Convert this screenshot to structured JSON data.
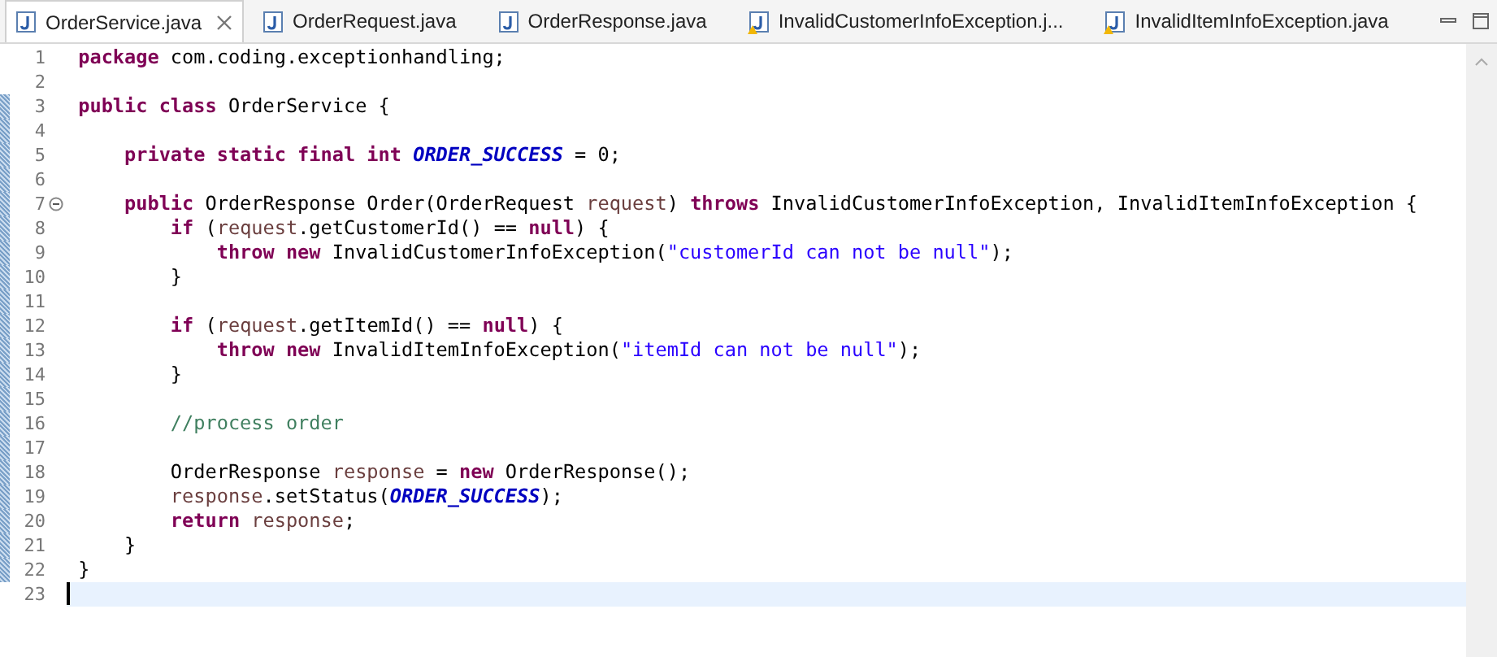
{
  "tabs": [
    {
      "label": "OrderService.java",
      "selected": true,
      "warning": false,
      "closable": true
    },
    {
      "label": "OrderRequest.java",
      "selected": false,
      "warning": false,
      "closable": false
    },
    {
      "label": "OrderResponse.java",
      "selected": false,
      "warning": false,
      "closable": false
    },
    {
      "label": "InvalidCustomerInfoException.j...",
      "selected": false,
      "warning": true,
      "closable": false
    },
    {
      "label": "InvalidItemInfoException.java",
      "selected": false,
      "warning": true,
      "closable": false
    }
  ],
  "editor": {
    "lines": [
      {
        "number": "1",
        "changed": false,
        "foldable": false,
        "current": false,
        "tokens": [
          {
            "kind": "keyword",
            "text": "package"
          },
          {
            "kind": "plain",
            "text": " com.coding.exceptionhandling;"
          }
        ]
      },
      {
        "number": "2",
        "changed": false,
        "foldable": false,
        "current": false
      },
      {
        "number": "3",
        "changed": true,
        "foldable": false,
        "current": false,
        "tokens": [
          {
            "kind": "keyword",
            "text": "public class"
          },
          {
            "kind": "plain",
            "text": " OrderService {"
          }
        ]
      },
      {
        "number": "4",
        "changed": true,
        "foldable": false,
        "current": false
      },
      {
        "number": "5",
        "changed": true,
        "foldable": false,
        "current": false,
        "tokens": [
          {
            "kind": "keyword",
            "text": "    private static final int"
          },
          {
            "kind": "constant",
            "text": " ORDER_SUCCESS"
          },
          {
            "kind": "plain",
            "text": " = 0;"
          }
        ]
      },
      {
        "number": "6",
        "changed": true,
        "foldable": false,
        "current": false
      },
      {
        "number": "7",
        "changed": true,
        "foldable": true,
        "current": false,
        "tokens": [
          {
            "kind": "keyword",
            "text": "    public"
          },
          {
            "kind": "plain",
            "text": " OrderResponse Order(OrderRequest "
          },
          {
            "kind": "variable",
            "text": "request"
          },
          {
            "kind": "plain",
            "text": ") "
          },
          {
            "kind": "keyword",
            "text": "throws"
          },
          {
            "kind": "plain",
            "text": " InvalidCustomerInfoException, InvalidItemInfoException {"
          }
        ]
      },
      {
        "number": "8",
        "changed": true,
        "foldable": false,
        "current": false,
        "tokens": [
          {
            "kind": "keyword",
            "text": "        if"
          },
          {
            "kind": "plain",
            "text": " ("
          },
          {
            "kind": "variable",
            "text": "request"
          },
          {
            "kind": "plain",
            "text": ".getCustomerId() == "
          },
          {
            "kind": "keyword",
            "text": "null"
          },
          {
            "kind": "plain",
            "text": ") {"
          }
        ]
      },
      {
        "number": "9",
        "changed": true,
        "foldable": false,
        "current": false,
        "tokens": [
          {
            "kind": "keyword",
            "text": "            throw new"
          },
          {
            "kind": "plain",
            "text": " InvalidCustomerInfoException("
          },
          {
            "kind": "string",
            "text": "\"customerId can not be null\""
          },
          {
            "kind": "plain",
            "text": ");"
          }
        ]
      },
      {
        "number": "10",
        "changed": true,
        "foldable": false,
        "current": false,
        "tokens": [
          {
            "kind": "plain",
            "text": "        }"
          }
        ]
      },
      {
        "number": "11",
        "changed": true,
        "foldable": false,
        "current": false
      },
      {
        "number": "12",
        "changed": true,
        "foldable": false,
        "current": false,
        "tokens": [
          {
            "kind": "keyword",
            "text": "        if"
          },
          {
            "kind": "plain",
            "text": " ("
          },
          {
            "kind": "variable",
            "text": "request"
          },
          {
            "kind": "plain",
            "text": ".getItemId() == "
          },
          {
            "kind": "keyword",
            "text": "null"
          },
          {
            "kind": "plain",
            "text": ") {"
          }
        ]
      },
      {
        "number": "13",
        "changed": true,
        "foldable": false,
        "current": false,
        "tokens": [
          {
            "kind": "keyword",
            "text": "            throw new"
          },
          {
            "kind": "plain",
            "text": " InvalidItemInfoException("
          },
          {
            "kind": "string",
            "text": "\"itemId can not be null\""
          },
          {
            "kind": "plain",
            "text": ");"
          }
        ]
      },
      {
        "number": "14",
        "changed": true,
        "foldable": false,
        "current": false,
        "tokens": [
          {
            "kind": "plain",
            "text": "        }"
          }
        ]
      },
      {
        "number": "15",
        "changed": true,
        "foldable": false,
        "current": false
      },
      {
        "number": "16",
        "changed": true,
        "foldable": false,
        "current": false,
        "tokens": [
          {
            "kind": "comment",
            "text": "        //process order"
          }
        ]
      },
      {
        "number": "17",
        "changed": true,
        "foldable": false,
        "current": false
      },
      {
        "number": "18",
        "changed": true,
        "foldable": false,
        "current": false,
        "tokens": [
          {
            "kind": "plain",
            "text": "        OrderResponse "
          },
          {
            "kind": "variable",
            "text": "response"
          },
          {
            "kind": "plain",
            "text": " = "
          },
          {
            "kind": "keyword",
            "text": "new"
          },
          {
            "kind": "plain",
            "text": " OrderResponse();"
          }
        ]
      },
      {
        "number": "19",
        "changed": true,
        "foldable": false,
        "current": false,
        "tokens": [
          {
            "kind": "variable",
            "text": "        response"
          },
          {
            "kind": "plain",
            "text": ".setStatus("
          },
          {
            "kind": "constant",
            "text": "ORDER_SUCCESS"
          },
          {
            "kind": "plain",
            "text": ");"
          }
        ]
      },
      {
        "number": "20",
        "changed": true,
        "foldable": false,
        "current": false,
        "tokens": [
          {
            "kind": "keyword",
            "text": "        return"
          },
          {
            "kind": "variable",
            "text": " response"
          },
          {
            "kind": "plain",
            "text": ";"
          }
        ]
      },
      {
        "number": "21",
        "changed": true,
        "foldable": false,
        "current": false,
        "tokens": [
          {
            "kind": "plain",
            "text": "    }"
          }
        ]
      },
      {
        "number": "22",
        "changed": true,
        "foldable": false,
        "current": false,
        "tokens": [
          {
            "kind": "plain",
            "text": "}"
          }
        ]
      },
      {
        "number": "23",
        "changed": false,
        "foldable": false,
        "current": true
      }
    ]
  }
}
